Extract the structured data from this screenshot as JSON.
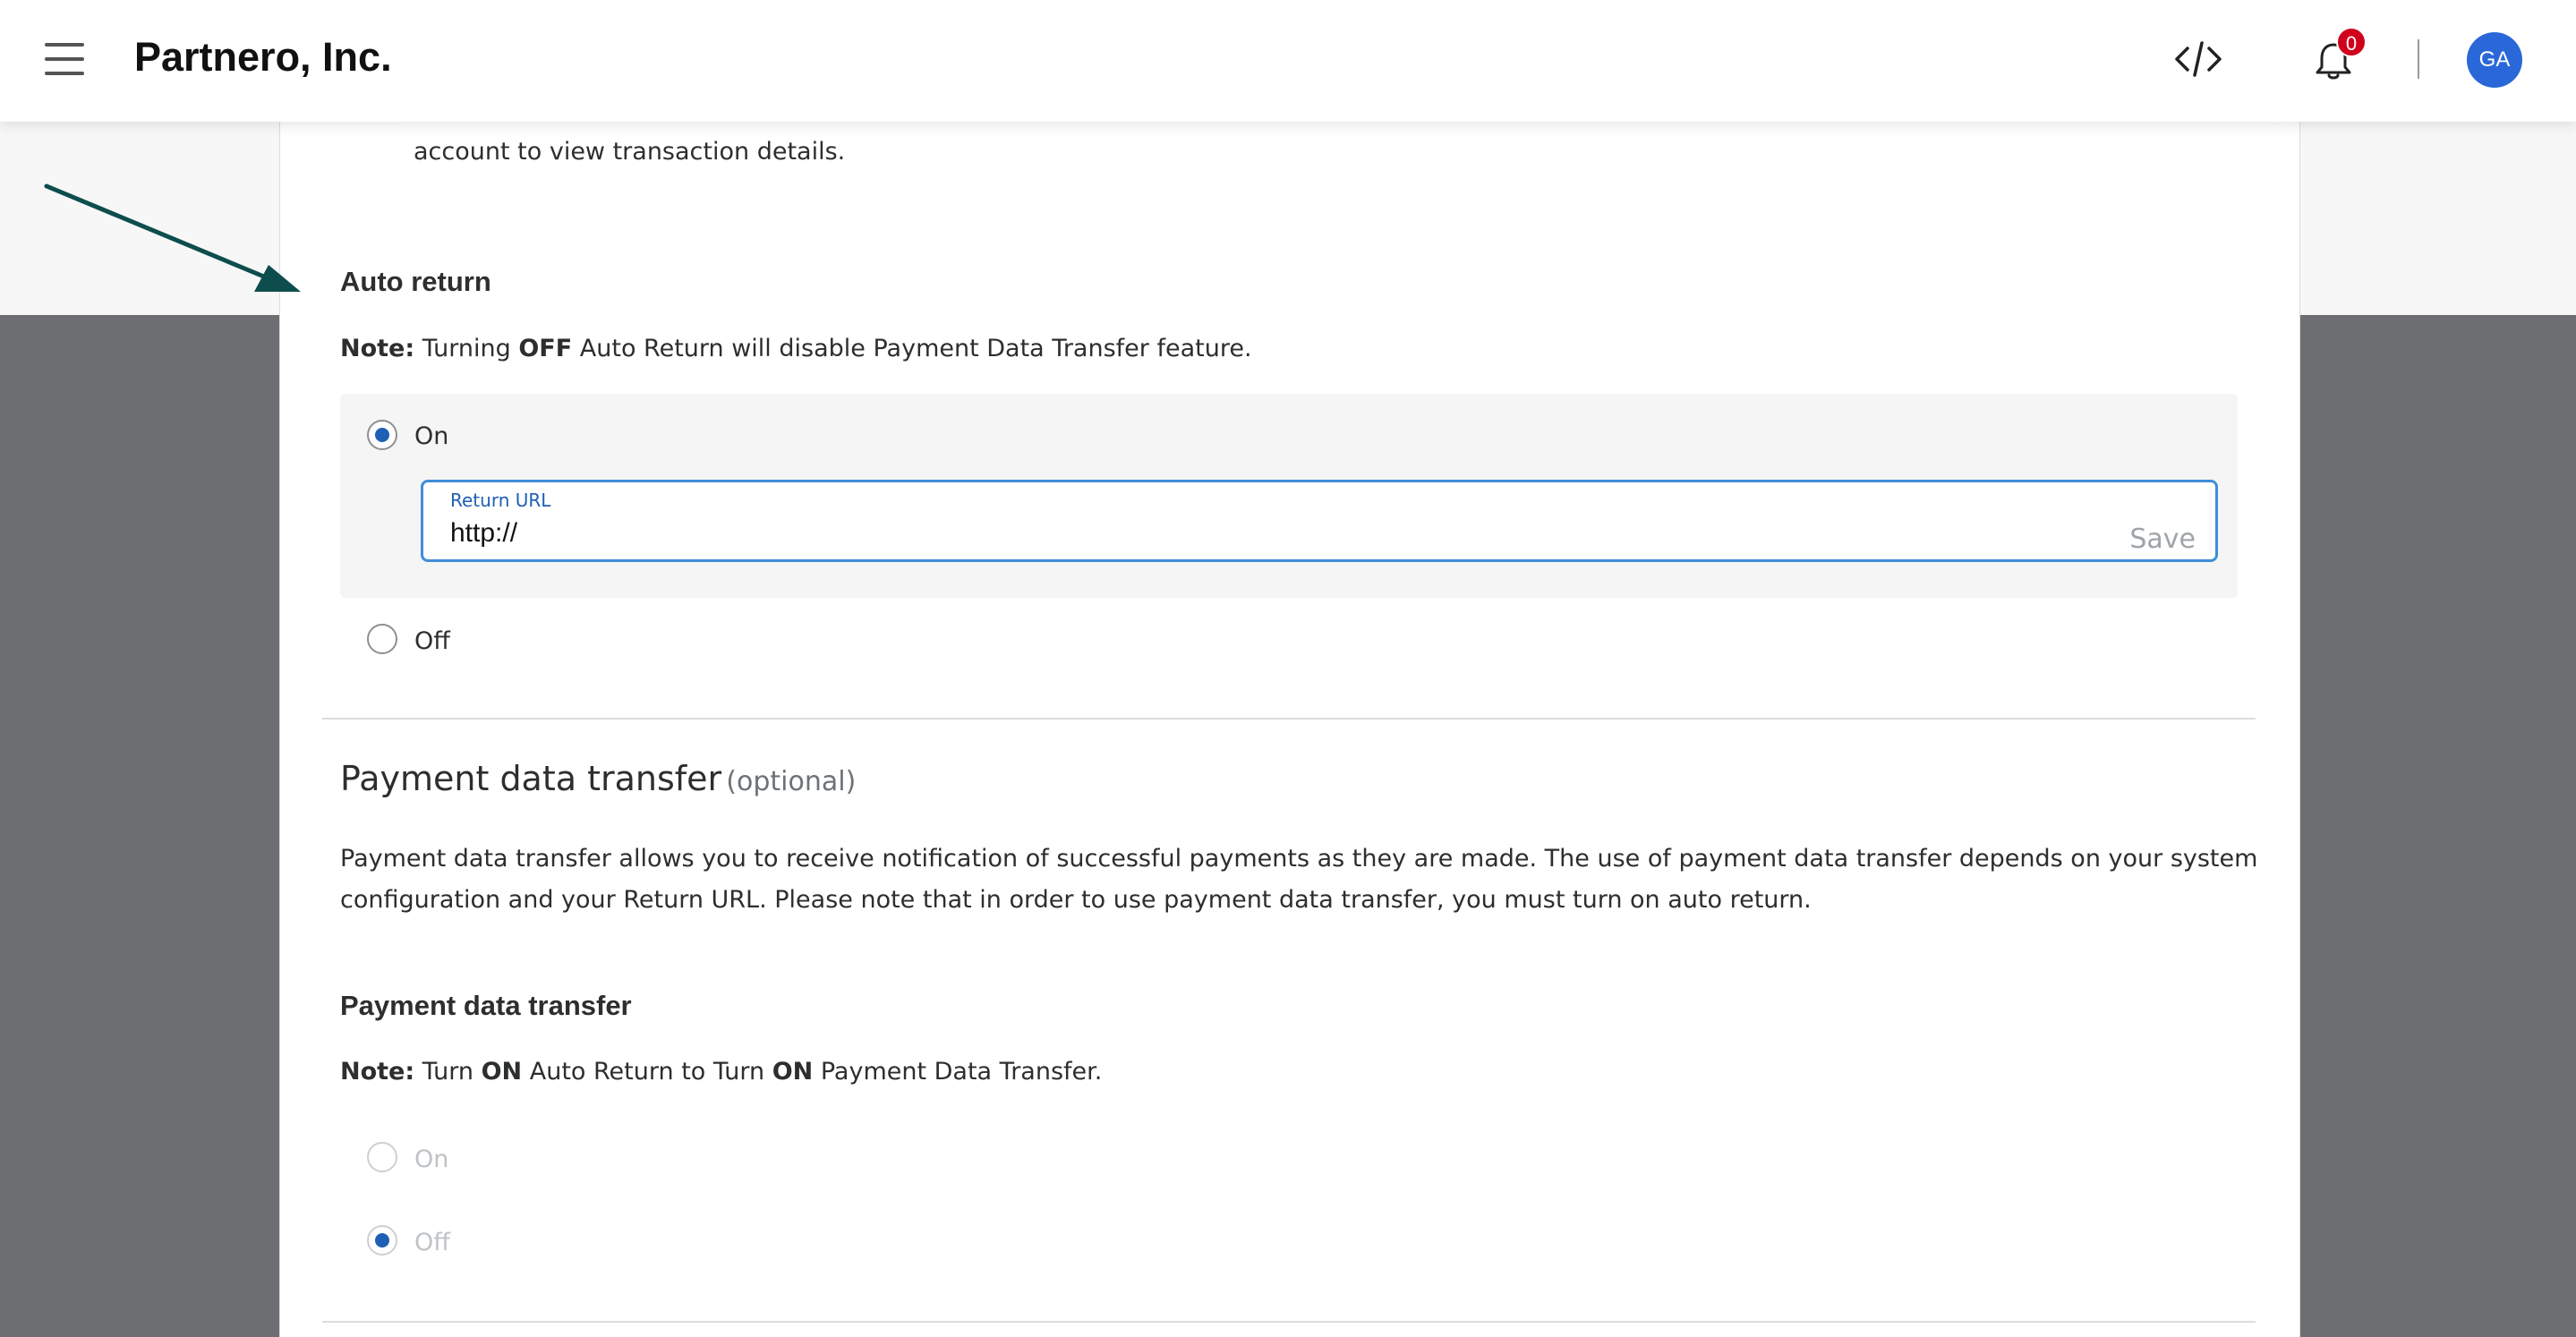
{
  "header": {
    "brand": "Partnero, Inc.",
    "notification_count": "0",
    "avatar_initials": "GA"
  },
  "intro": {
    "line_end": "account to view transaction details."
  },
  "auto_return": {
    "title": "Auto return",
    "note_label": "Note:",
    "note_before": " Turning ",
    "note_bold": "OFF",
    "note_after": " Auto Return will disable Payment Data Transfer feature.",
    "options": [
      {
        "label": "On",
        "checked": true
      },
      {
        "label": "Off",
        "checked": false
      }
    ],
    "return_url": {
      "label": "Return URL",
      "value": "http://",
      "save_label": "Save"
    }
  },
  "pdt_section": {
    "title": "Payment data transfer",
    "optional": "(optional)",
    "description_line1": "Payment data transfer allows you to receive notification of successful payments as they are made. The use of payment data transfer depends on your system",
    "description_line2": "configuration and your Return URL. Please note that in order to use payment data transfer, you must turn on auto return."
  },
  "pdt_setting": {
    "title": "Payment data transfer",
    "note_label": "Note:",
    "note_part1": " Turn ",
    "note_bold1": "ON",
    "note_part2": " Auto Return to Turn ",
    "note_bold2": "ON",
    "note_part3": " Payment Data Transfer.",
    "options": [
      {
        "label": "On",
        "checked": false
      },
      {
        "label": "Off",
        "checked": true
      }
    ]
  },
  "colors": {
    "accent": "#1f5fb4",
    "input_border": "#3f8ed8",
    "badge": "#d0021b",
    "avatar": "#2a68d9",
    "arrow": "#0e4d4d"
  }
}
